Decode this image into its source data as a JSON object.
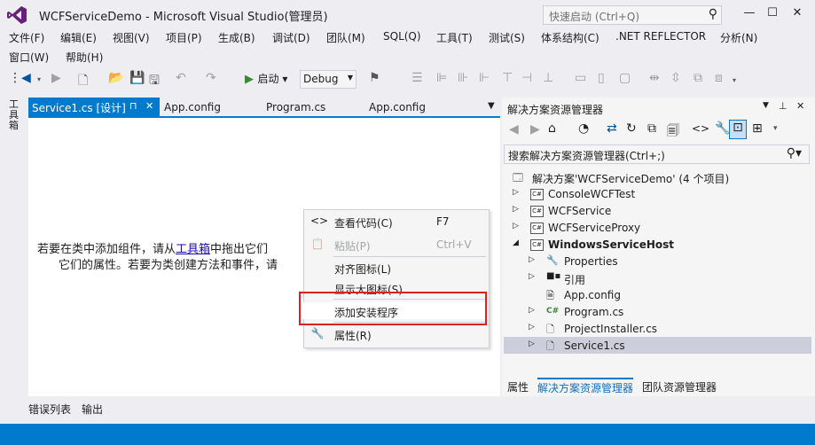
{
  "window": {
    "title": "WCFServiceDemo - Microsoft Visual Studio(管理员)",
    "quick_launch_placeholder": "快速启动 (Ctrl+Q)",
    "minimize": "—",
    "maximize": "☐",
    "close": "✕"
  },
  "menu": [
    "文件(F)",
    "编辑(E)",
    "视图(V)",
    "项目(P)",
    "生成(B)",
    "调试(D)",
    "团队(M)",
    "SQL(Q)",
    "工具(T)",
    "测试(S)",
    "体系结构(C)",
    ".NET REFLECTOR",
    "分析(N)",
    "窗口(W)",
    "帮助(H)"
  ],
  "toolbar": {
    "start_label": "启动",
    "configuration": "Debug"
  },
  "toolbox_label": "工具箱",
  "tabs": {
    "active": "Service1.cs [设计]",
    "pin": "⊓",
    "close": "✕",
    "others": [
      "App.config",
      "Program.cs",
      "App.config"
    ]
  },
  "designer": {
    "line1_before": "若要在类中添加组件，请从",
    "line1_link": "工具箱",
    "line1_after": "中拖出它们",
    "line2": "它们的属性。若要为类创建方法和事件，请"
  },
  "context_menu": [
    {
      "icon": "<>",
      "label": "查看代码(C)",
      "shortcut": "F7",
      "enabled": true
    },
    {
      "icon": "📋",
      "label": "粘贴(P)",
      "shortcut": "Ctrl+V",
      "enabled": false
    },
    {
      "icon": "",
      "label": "对齐图标(L)",
      "shortcut": "",
      "enabled": true
    },
    {
      "icon": "",
      "label": "显示大图标(S)",
      "shortcut": "",
      "enabled": true
    },
    {
      "icon": "",
      "label": "添加安装程序",
      "shortcut": "",
      "enabled": true
    },
    {
      "icon": "🔧",
      "label": "属性(R)",
      "shortcut": "",
      "enabled": true
    }
  ],
  "solution_explorer": {
    "title": "解决方案资源管理器",
    "search_placeholder": "搜索解决方案资源管理器(Ctrl+;)",
    "tree": [
      {
        "label": "解决方案'WCFServiceDemo' (4 个项目)",
        "indent": 0,
        "expander": "",
        "icon": "sln"
      },
      {
        "label": "ConsoleWCFTest",
        "indent": 1,
        "expander": "▷",
        "icon": "csproj"
      },
      {
        "label": "WCFService",
        "indent": 1,
        "expander": "▷",
        "icon": "csproj"
      },
      {
        "label": "WCFServiceProxy",
        "indent": 1,
        "expander": "▷",
        "icon": "csproj"
      },
      {
        "label": "WindowsServiceHost",
        "indent": 1,
        "expander": "◢",
        "icon": "csproj",
        "bold": true
      },
      {
        "label": "Properties",
        "indent": 2,
        "expander": "▷",
        "icon": "wrench"
      },
      {
        "label": "引用",
        "indent": 2,
        "expander": "▷",
        "icon": "refs"
      },
      {
        "label": "App.config",
        "indent": 2,
        "expander": "",
        "icon": "config"
      },
      {
        "label": "Program.cs",
        "indent": 2,
        "expander": "▷",
        "icon": "cs"
      },
      {
        "label": "ProjectInstaller.cs",
        "indent": 2,
        "expander": "▷",
        "icon": "file"
      },
      {
        "label": "Service1.cs",
        "indent": 2,
        "expander": "▷",
        "icon": "file",
        "selected": true
      }
    ],
    "bottom_tabs": [
      "属性",
      "解决方案资源管理器",
      "团队资源管理器"
    ]
  },
  "bottom_tabs": [
    "错误列表",
    "输出"
  ],
  "colors": {
    "accent": "#007acc",
    "highlight_box": "#e02020"
  }
}
